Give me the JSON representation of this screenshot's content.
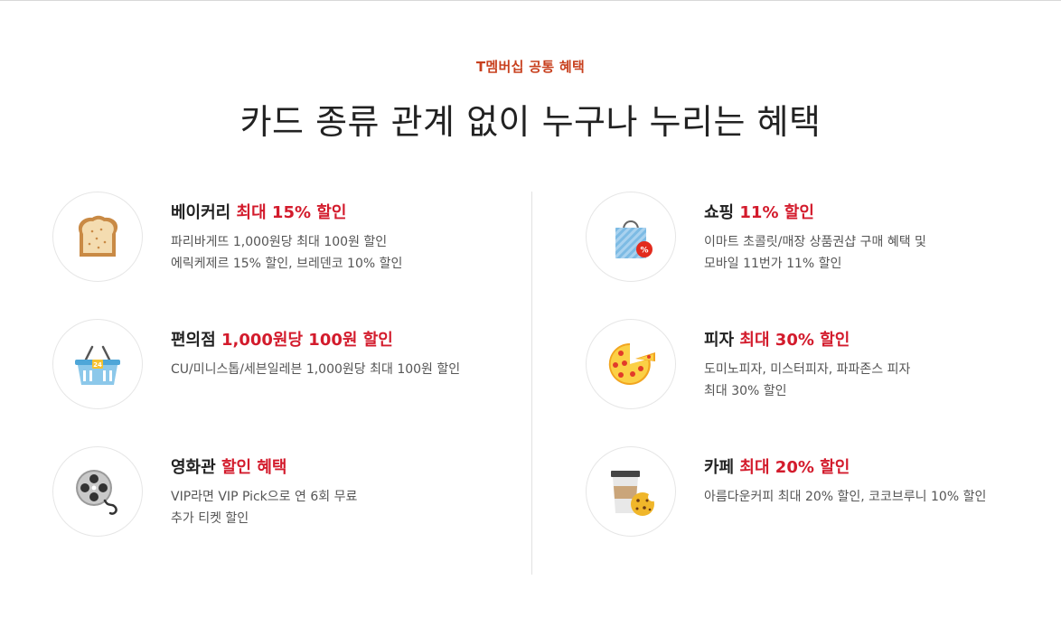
{
  "header": {
    "eyebrow": "T멤버십 공통 혜택",
    "headline": "카드 종류 관계 없이 누구나 누리는 혜택"
  },
  "colors": {
    "accent": "#c8401e",
    "highlight": "#d31b2c"
  },
  "benefits": [
    {
      "icon": "bread-icon",
      "title_main": "베이커리",
      "title_highlight": "최대 15% 할인",
      "desc": [
        "파리바게뜨 1,000원당 최대 100원 할인",
        "에릭케제르 15% 할인, 브레덴코 10% 할인"
      ]
    },
    {
      "icon": "shopping-bag-icon",
      "title_main": "쇼핑",
      "title_highlight": "11% 할인",
      "desc": [
        "이마트 초콜릿/매장 상품권샵 구매 혜택 및",
        "모바일 11번가 11% 할인"
      ]
    },
    {
      "icon": "basket-icon",
      "badge": "24",
      "title_main": "편의점",
      "title_highlight": "1,000원당 100원 할인",
      "desc": [
        "CU/미니스톱/세븐일레븐 1,000원당 최대 100원 할인"
      ]
    },
    {
      "icon": "pizza-icon",
      "title_main": "피자",
      "title_highlight": "최대 30% 할인",
      "desc": [
        "도미노피자, 미스터피자, 파파존스 피자",
        "최대 30% 할인"
      ]
    },
    {
      "icon": "film-reel-icon",
      "title_main": "영화관",
      "title_highlight": "할인 혜택",
      "desc": [
        "VIP라면 VIP Pick으로 연 6회 무료",
        "추가 티켓 할인"
      ]
    },
    {
      "icon": "coffee-cookie-icon",
      "title_main": "카페",
      "title_highlight": "최대 20% 할인",
      "desc": [
        "아름다운커피 최대 20% 할인, 코코브루니 10% 할인"
      ]
    }
  ]
}
